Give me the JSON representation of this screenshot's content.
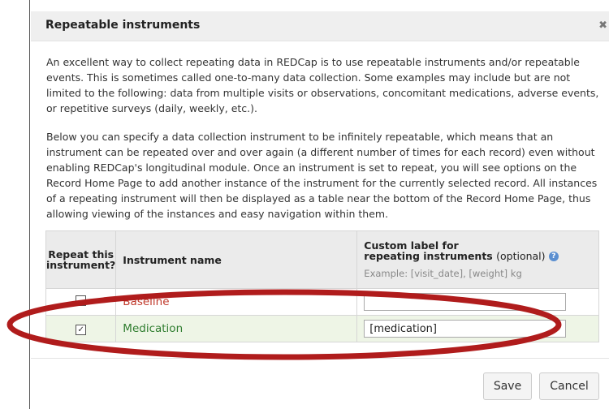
{
  "dialog": {
    "title": "Repeatable instruments",
    "close_glyph": "✖",
    "paragraph1": "An excellent way to collect repeating data in REDCap is to use repeatable instruments and/or repeatable events. This is sometimes called one-to-many data collection. Some examples may include but are not limited to the following: data from multiple visits or observations, concomitant medications, adverse events, or repetitive surveys (daily, weekly, etc.).",
    "paragraph2": "Below you can specify a data collection instrument to be infinitely repeatable, which means that an instrument can be repeated over and over again (a different number of times for each record) even without enabling REDCap's longitudinal module. Once an instrument is set to repeat, you will see options on the Record Home Page to add another instance of the instrument for the currently selected record. All instances of a repeating instrument will then be displayed as a table near the bottom of the Record Home Page, thus allowing viewing of the instances and easy navigation within them."
  },
  "table": {
    "headers": {
      "repeat_line1": "Repeat this",
      "repeat_line2": "instrument?",
      "name": "Instrument name",
      "custom_label_line1": "Custom label for",
      "custom_label_line2": "repeating instruments",
      "optional": "(optional)",
      "example": "Example: [visit_date], [weight] kg"
    },
    "rows": [
      {
        "name": "Baseline",
        "checked": false,
        "label_value": ""
      },
      {
        "name": "Medication",
        "checked": true,
        "check_glyph": "✓",
        "label_value": "[medication]"
      }
    ]
  },
  "buttons": {
    "save": "Save",
    "cancel": "Cancel"
  },
  "colors": {
    "annotation_oval": "#b01c1c",
    "baseline_text": "#c0392b",
    "medication_text": "#2f7d2f",
    "medication_row_bg": "#eef5e6",
    "help_icon": "#5b8fd0"
  },
  "icons": {
    "help": "question-circle-icon",
    "close": "close-icon"
  }
}
